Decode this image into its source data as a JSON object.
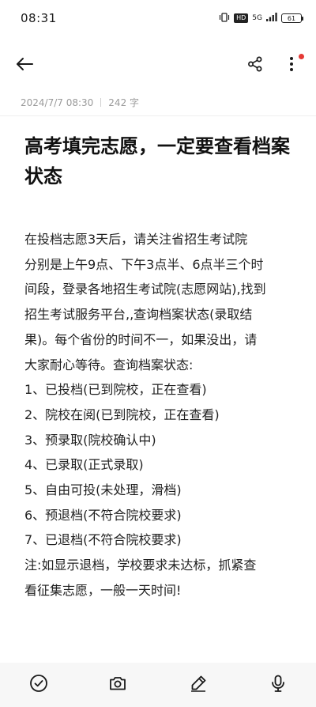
{
  "status_bar": {
    "time": "08:31",
    "hd": "HD",
    "network": "5G",
    "battery": "61"
  },
  "note": {
    "date": "2024/7/7 08:30",
    "word_count": "242 字",
    "title": "高考填完志愿，一定要查看档案状态",
    "body_lines": [
      "在投档志愿3天后，请关注省招生考试院",
      "分别是上午9点、下午3点半、6点半三个时",
      "间段，登录各地招生考试院(志愿网站),找到",
      "招生考试服务平台,,查询档案状态(录取结",
      "果)。每个省份的时间不一，如果没出，请",
      "大家耐心等待。查询档案状态:",
      "1、已投档(已到院校，正在查看)",
      "2、院校在阅(已到院校，正在查看)",
      "3、预录取(院校确认中)",
      "4、已录取(正式录取)",
      "5、自由可投(未处理，滑档)",
      "6、预退档(不符合院校要求)",
      "7、已退档(不符合院校要求)",
      "注:如显示退档，学校要求未达标，抓紧查",
      "看征集志愿，一般一天时间!"
    ]
  },
  "icons": {
    "back": "arrow-left-icon",
    "share": "share-icon",
    "more": "more-vertical-icon",
    "checklist": "check-circle-icon",
    "camera": "camera-icon",
    "handwrite": "pen-icon",
    "voice": "microphone-icon"
  },
  "colors": {
    "notification_dot": "#e53935",
    "meta_text": "#9a9a9a",
    "bottom_bar_bg": "#f7f7f7"
  }
}
